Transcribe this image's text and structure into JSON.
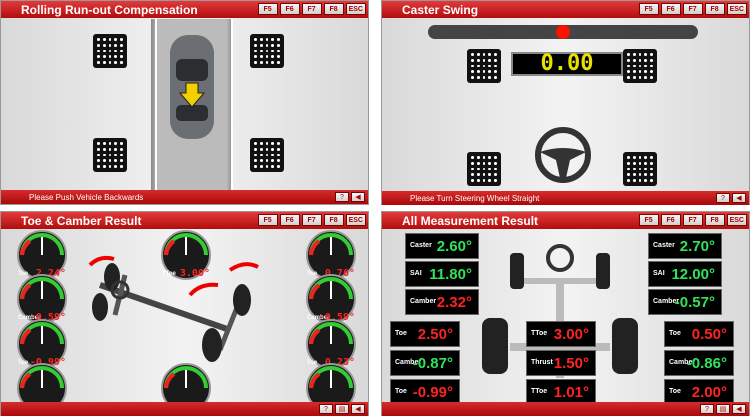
{
  "panels": [
    {
      "title": "Rolling Run-out Compensation",
      "footer": "Please Push Vehicle Backwards"
    },
    {
      "title": "Caster Swing",
      "footer": "Please Turn Steering Wheel Straight",
      "readout": "0.00"
    },
    {
      "title": "Toe & Camber Result",
      "footer": ""
    },
    {
      "title": "All Measurement Result",
      "footer": ""
    }
  ],
  "keys": [
    "F5",
    "F6",
    "F7",
    "F8",
    "ESC"
  ],
  "toe_camber": {
    "left": [
      {
        "label": "Toe",
        "value": "2.24°"
      },
      {
        "label": "Camber",
        "value": "-0.59°"
      },
      {
        "label": "Toe",
        "value": "-0.99°"
      },
      {
        "label": "Camber",
        "value": "-0.87°"
      }
    ],
    "center": [
      {
        "label": "TToe",
        "value": "3.00°"
      },
      {
        "label": "TToe",
        "value": "-0.76°"
      }
    ],
    "right": [
      {
        "label": "Toe",
        "value": "0.76°"
      },
      {
        "label": "Camber",
        "value": "-0.59°"
      },
      {
        "label": "Toe",
        "value": "0.23°"
      },
      {
        "label": "Camber",
        "value": "-0.86°"
      }
    ]
  },
  "all": {
    "front_left": [
      {
        "label": "Caster",
        "value": "2.60°",
        "color": "green"
      },
      {
        "label": "SAI",
        "value": "11.80°",
        "color": "green"
      },
      {
        "label": "Camber",
        "value": "2.32°",
        "color": "red"
      }
    ],
    "front_right": [
      {
        "label": "Caster",
        "value": "2.70°",
        "color": "green"
      },
      {
        "label": "SAI",
        "value": "12.00°",
        "color": "green"
      },
      {
        "label": "Camber",
        "value": "-0.57°",
        "color": "green"
      }
    ],
    "rear_left": [
      {
        "label": "Toe",
        "value": "2.50°",
        "color": "red"
      },
      {
        "label": "Camber",
        "value": "-0.87°",
        "color": "green"
      },
      {
        "label": "Toe",
        "value": "-0.99°",
        "color": "red"
      }
    ],
    "center": [
      {
        "label": "TToe",
        "value": "3.00°",
        "color": "red"
      },
      {
        "label": "Thrust",
        "value": "1.50°",
        "color": "red"
      },
      {
        "label": "TToe",
        "value": "1.01°",
        "color": "red"
      }
    ],
    "rear_right": [
      {
        "label": "Toe",
        "value": "0.50°",
        "color": "red"
      },
      {
        "label": "Camber",
        "value": "-0.86°",
        "color": "green"
      },
      {
        "label": "Toe",
        "value": "2.00°",
        "color": "red"
      }
    ]
  }
}
